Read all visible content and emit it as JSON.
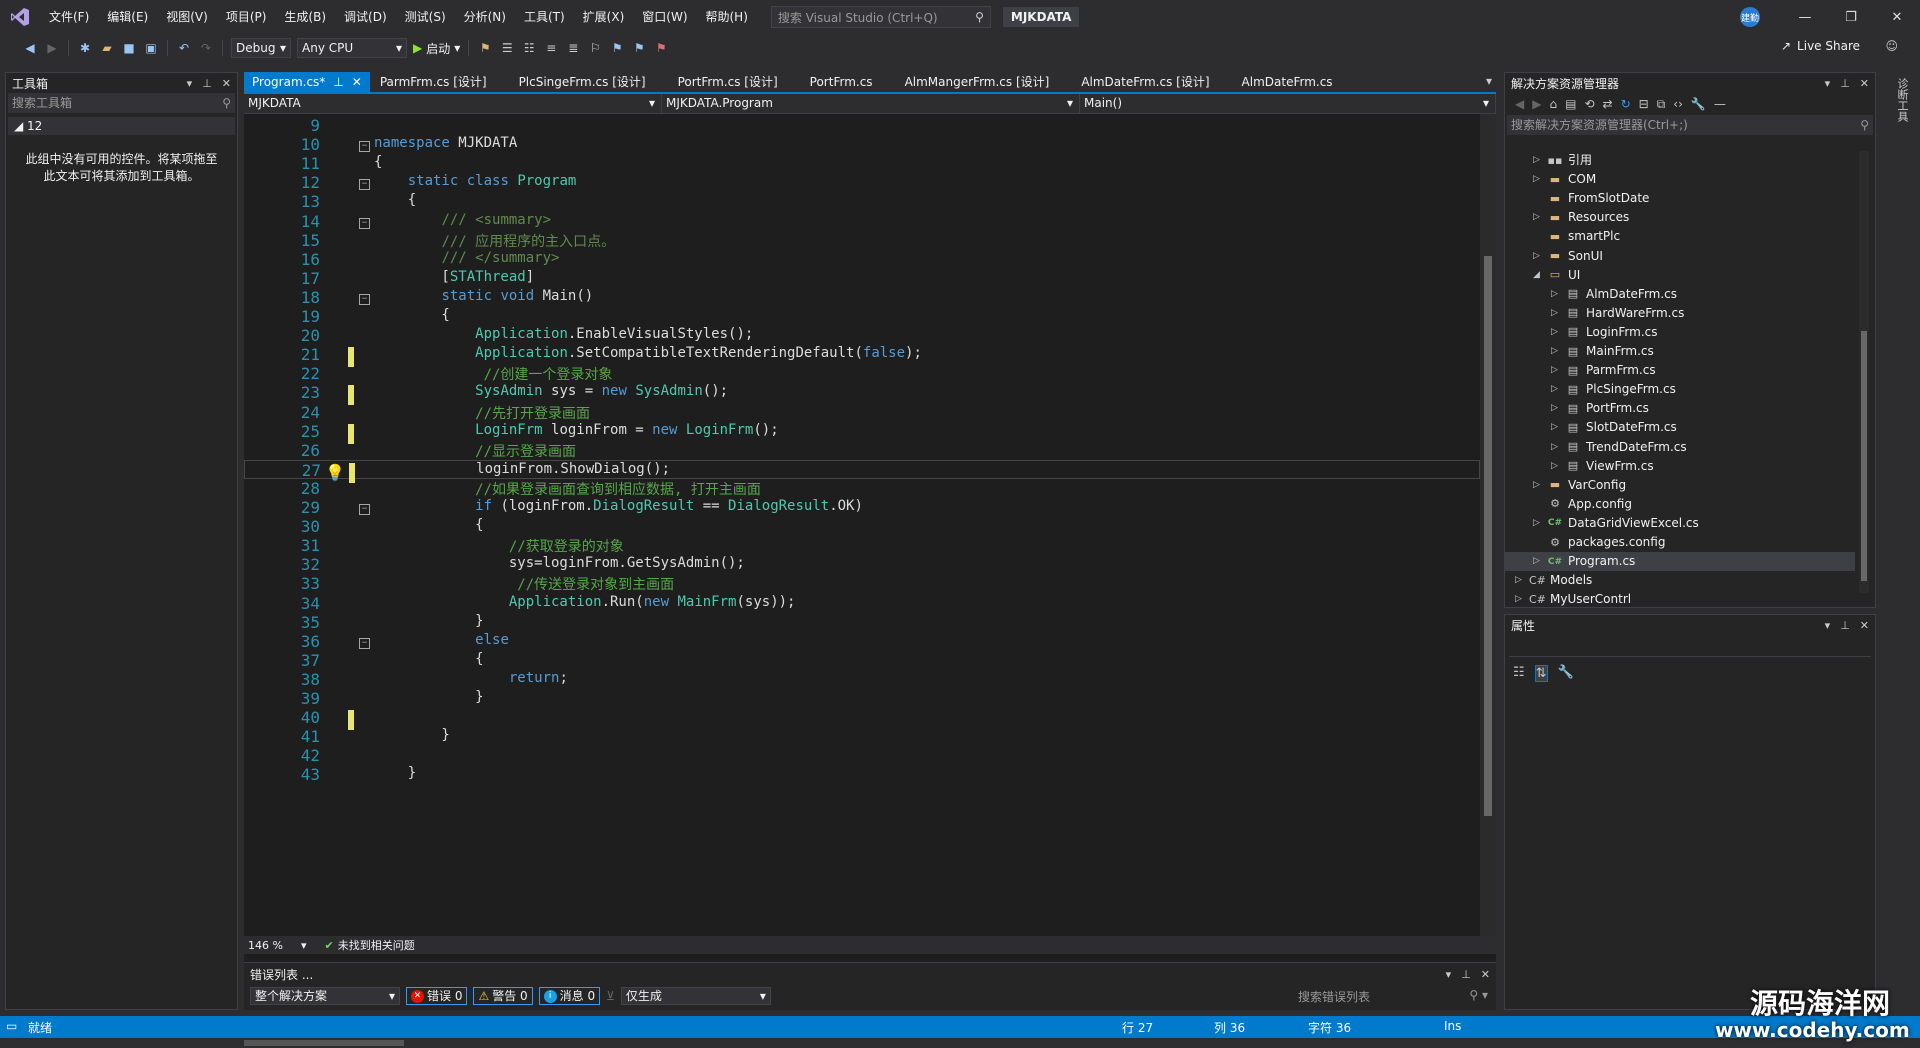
{
  "menu": {
    "items": [
      "文件(F)",
      "编辑(E)",
      "视图(V)",
      "项目(P)",
      "生成(B)",
      "调试(D)",
      "测试(S)",
      "分析(N)",
      "工具(T)",
      "扩展(X)",
      "窗口(W)",
      "帮助(H)"
    ],
    "search_placeholder": "搜索 Visual Studio (Ctrl+Q)",
    "solution_name": "MJKDATA",
    "user_badge": "建勤"
  },
  "toolbar": {
    "config": "Debug",
    "platform": "Any CPU",
    "start_label": "启动",
    "liveshare_label": "Live Share"
  },
  "toolbox": {
    "title": "工具箱",
    "search_placeholder": "搜索工具箱",
    "group": "◢ 12",
    "empty_message": "此组中没有可用的控件。将某项拖至此文本可将其添加到工具箱。"
  },
  "editor": {
    "tabs": [
      "Program.cs*",
      "ParmFrm.cs [设计]",
      "PlcSingeFrm.cs [设计]",
      "PortFrm.cs [设计]",
      "PortFrm.cs",
      "AlmMangerFrm.cs [设计]",
      "AlmDateFrm.cs [设计]",
      "AlmDateFrm.cs"
    ],
    "nav_project": "MJKDATA",
    "nav_class": "MJKDATA.Program",
    "nav_member": "Main()",
    "zoom": "146 %",
    "issues": "未找到相关问题",
    "lines": [
      {
        "n": "9",
        "t": ""
      },
      {
        "n": "10",
        "t": "namespace MJKDATA"
      },
      {
        "n": "11",
        "t": "{"
      },
      {
        "n": "12",
        "t": "    static class Program"
      },
      {
        "n": "13",
        "t": "    {"
      },
      {
        "n": "14",
        "t": "        /// <summary>"
      },
      {
        "n": "15",
        "t": "        /// 应用程序的主入口点。"
      },
      {
        "n": "16",
        "t": "        /// </summary>"
      },
      {
        "n": "17",
        "t": "        [STAThread]"
      },
      {
        "n": "18",
        "t": "        static void Main()"
      },
      {
        "n": "19",
        "t": "        {"
      },
      {
        "n": "20",
        "t": "            Application.EnableVisualStyles();"
      },
      {
        "n": "21",
        "t": "            Application.SetCompatibleTextRenderingDefault(false);"
      },
      {
        "n": "22",
        "t": "             //创建一个登录对象"
      },
      {
        "n": "23",
        "t": "            SysAdmin sys = new SysAdmin();"
      },
      {
        "n": "24",
        "t": "            //先打开登录画面"
      },
      {
        "n": "25",
        "t": "            LoginFrm loginFrom = new LoginFrm();"
      },
      {
        "n": "26",
        "t": "            //显示登录画面"
      },
      {
        "n": "27",
        "t": "            loginFrom.ShowDialog();"
      },
      {
        "n": "28",
        "t": "            //如果登录画面查询到相应数据, 打开主画面"
      },
      {
        "n": "29",
        "t": "            if (loginFrom.DialogResult == DialogResult.OK)"
      },
      {
        "n": "30",
        "t": "            {"
      },
      {
        "n": "31",
        "t": "                //获取登录的对象"
      },
      {
        "n": "32",
        "t": "                sys=loginFrom.GetSysAdmin();"
      },
      {
        "n": "33",
        "t": "                 //传送登录对象到主画面"
      },
      {
        "n": "34",
        "t": "                Application.Run(new MainFrm(sys));"
      },
      {
        "n": "35",
        "t": "            }"
      },
      {
        "n": "36",
        "t": "            else"
      },
      {
        "n": "37",
        "t": "            {"
      },
      {
        "n": "38",
        "t": "                return;"
      },
      {
        "n": "39",
        "t": "            }"
      },
      {
        "n": "40",
        "t": ""
      },
      {
        "n": "41",
        "t": "        }"
      },
      {
        "n": "42",
        "t": ""
      },
      {
        "n": "43",
        "t": "    }"
      }
    ]
  },
  "errorlist": {
    "title": "错误列表 ...",
    "scope": "整个解决方案",
    "errors": "错误 0",
    "warnings": "警告 0",
    "messages": "消息 0",
    "build_filter": "仅生成",
    "search_placeholder": "搜索错误列表"
  },
  "solution_explorer": {
    "title": "解决方案资源管理器",
    "search_placeholder": "搜索解决方案资源管理器(Ctrl+;)",
    "items": [
      {
        "label": "引用",
        "icon": "references-icon"
      },
      {
        "label": "COM",
        "icon": "folder-icon"
      },
      {
        "label": "FromSlotDate",
        "icon": "folder-icon"
      },
      {
        "label": "Resources",
        "icon": "folder-icon"
      },
      {
        "label": "smartPlc",
        "icon": "folder-icon"
      },
      {
        "label": "SonUI",
        "icon": "folder-icon"
      },
      {
        "label": "UI",
        "icon": "folder-open-icon"
      },
      {
        "label": "AlmDateFrm.cs",
        "icon": "form-icon"
      },
      {
        "label": "HardWareFrm.cs",
        "icon": "form-icon"
      },
      {
        "label": "LoginFrm.cs",
        "icon": "form-icon"
      },
      {
        "label": "MainFrm.cs",
        "icon": "form-icon"
      },
      {
        "label": "ParmFrm.cs",
        "icon": "form-icon"
      },
      {
        "label": "PlcSingeFrm.cs",
        "icon": "form-icon"
      },
      {
        "label": "PortFrm.cs",
        "icon": "form-icon"
      },
      {
        "label": "SlotDateFrm.cs",
        "icon": "form-icon"
      },
      {
        "label": "TrendDateFrm.cs",
        "icon": "form-icon"
      },
      {
        "label": "ViewFrm.cs",
        "icon": "form-icon"
      },
      {
        "label": "VarConfig",
        "icon": "folder-icon"
      },
      {
        "label": "App.config",
        "icon": "config-icon"
      },
      {
        "label": "DataGridViewExcel.cs",
        "icon": "csharp-file-icon"
      },
      {
        "label": "packages.config",
        "icon": "config-icon"
      },
      {
        "label": "Program.cs",
        "icon": "csharp-file-icon"
      },
      {
        "label": "Models",
        "icon": "csharp-project-icon"
      },
      {
        "label": "MyUserContrl",
        "icon": "csharp-project-icon"
      }
    ]
  },
  "properties": {
    "title": "属性"
  },
  "right_strip": {
    "label": "诊断工具"
  },
  "statusbar": {
    "ready": "就绪",
    "line": "行 27",
    "col": "列 36",
    "char": "字符 36",
    "mode": "Ins"
  },
  "watermark": {
    "site_name": "源码海洋网",
    "url": "www.codehy.com"
  },
  "colors": {
    "accent": "#007acc",
    "background": "#2d2d30",
    "editor": "#1e1e1e"
  }
}
